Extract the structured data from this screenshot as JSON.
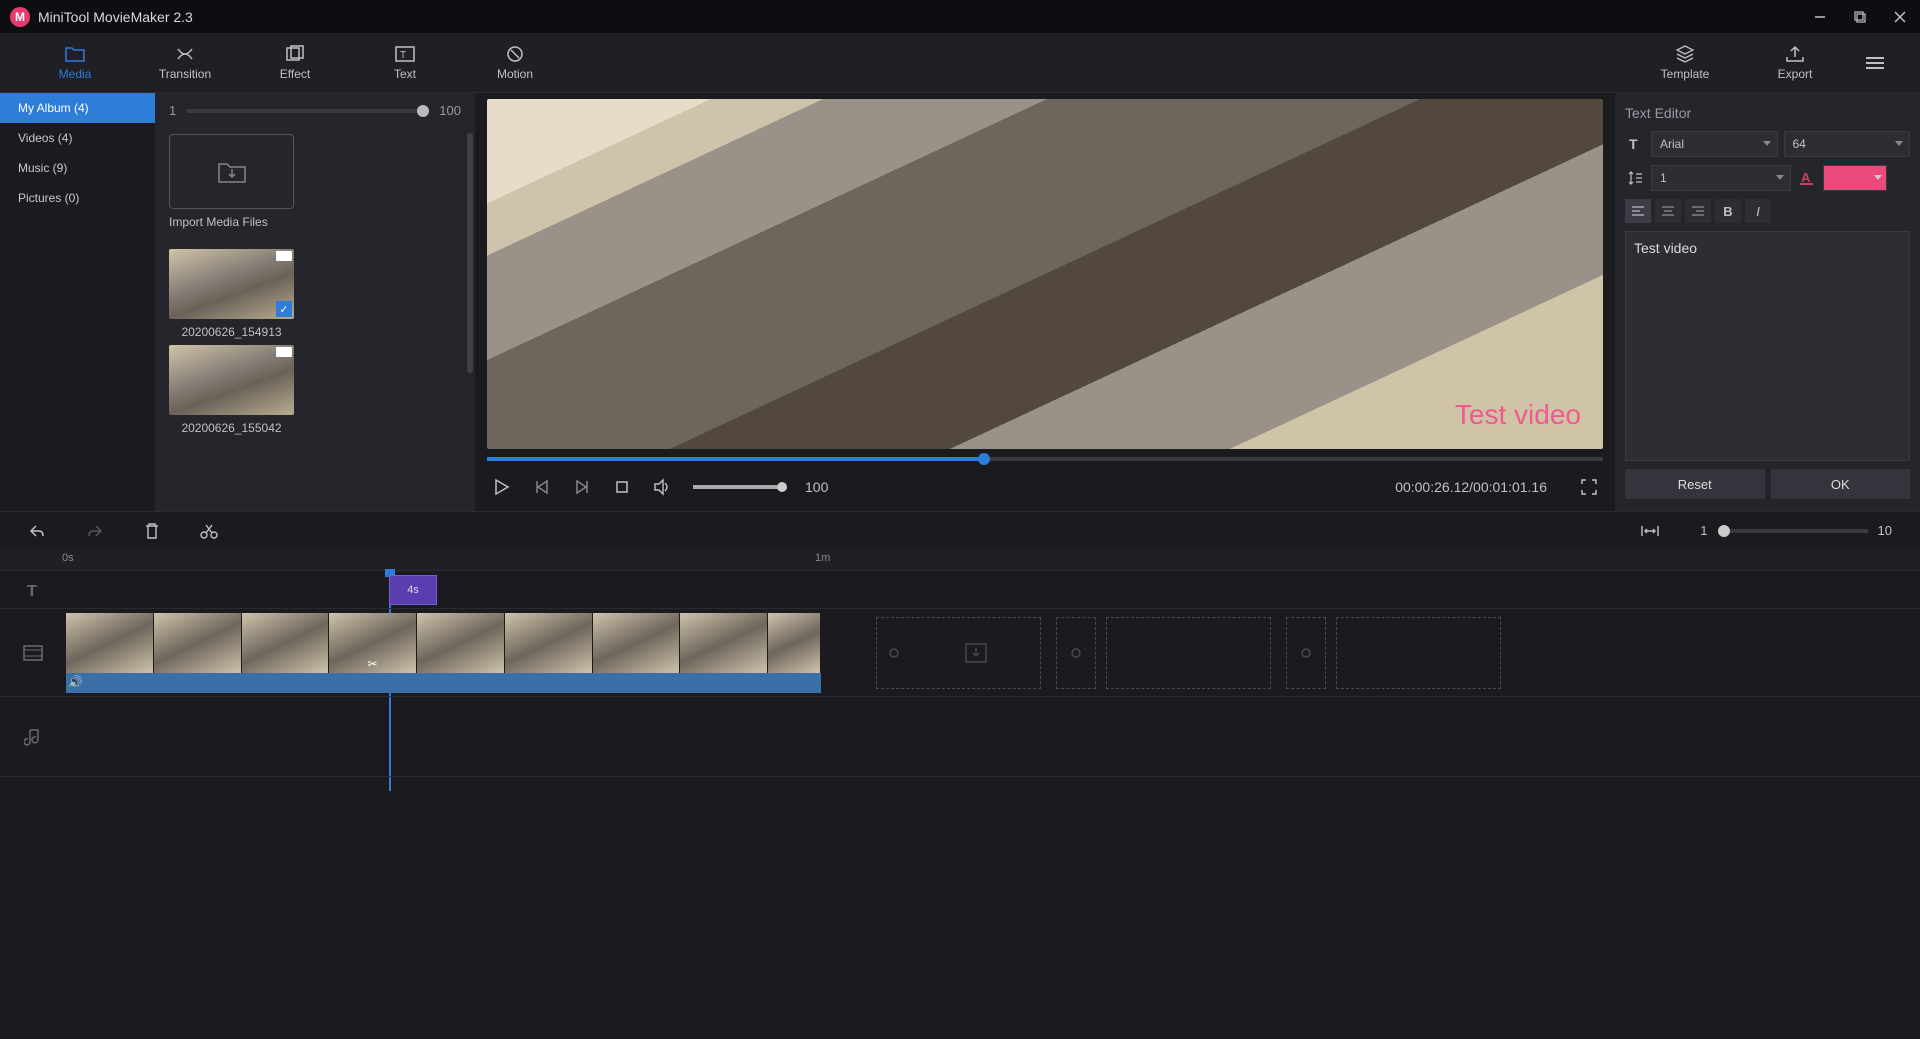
{
  "app": {
    "title": "MiniTool MovieMaker 2.3"
  },
  "ribbon": {
    "tabs": [
      {
        "label": "Media"
      },
      {
        "label": "Transition"
      },
      {
        "label": "Effect"
      },
      {
        "label": "Text"
      },
      {
        "label": "Motion"
      }
    ],
    "template_label": "Template",
    "export_label": "Export"
  },
  "sidebar": {
    "items": [
      {
        "label": "My Album  (4)"
      },
      {
        "label": "Videos  (4)"
      },
      {
        "label": "Music  (9)"
      },
      {
        "label": "Pictures  (0)"
      }
    ]
  },
  "mediapanel": {
    "zoom_min": "1",
    "zoom_max": "100",
    "import_label": "Import Media Files",
    "clips": [
      {
        "name": "20200626_154913",
        "checked": true
      },
      {
        "name": "20200626_155042",
        "checked": false
      }
    ]
  },
  "preview": {
    "overlay_text": "Test video",
    "volume_label": "100",
    "time": "00:00:26.12/00:01:01.16"
  },
  "texted": {
    "title": "Text Editor",
    "font": "Arial",
    "size": "64",
    "line": "1",
    "text_color": "#ed4a7c",
    "content": "Test video",
    "reset": "Reset",
    "ok": "OK"
  },
  "timeline": {
    "zoom_min": "1",
    "zoom_max": "10",
    "ruler": {
      "zero": "0s",
      "one_min": "1m"
    },
    "textclip_label": "4s"
  }
}
